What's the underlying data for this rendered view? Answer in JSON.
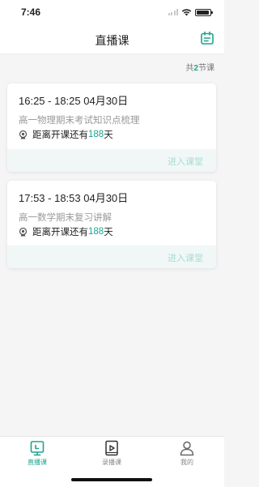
{
  "status_bar": {
    "time": "7:46"
  },
  "header": {
    "title": "直播课",
    "calendar_icon": "calendar-icon"
  },
  "summary": {
    "prefix": "共",
    "count": "2",
    "suffix": "节课"
  },
  "courses": [
    {
      "time": "16:25 - 18:25  04月30日",
      "title": "高一物理期末考试知识点梳理",
      "countdown_prefix": "距离开课还有",
      "days": "188",
      "countdown_suffix": "天",
      "enter_label": "进入课堂"
    },
    {
      "time": "17:53 - 18:53  04月30日",
      "title": "高一数学期末复习讲解",
      "countdown_prefix": "距离开课还有",
      "days": "188",
      "countdown_suffix": "天",
      "enter_label": "进入课堂"
    }
  ],
  "tabs": [
    {
      "label": "直播课",
      "icon": "live-tv-icon",
      "active": true
    },
    {
      "label": "录播课",
      "icon": "video-play-icon",
      "active": false
    },
    {
      "label": "我的",
      "icon": "user-icon",
      "active": false
    }
  ],
  "colors": {
    "accent": "#1ba58c",
    "enter_text": "#a8dccf",
    "footer_bg": "#f1f7f7"
  }
}
